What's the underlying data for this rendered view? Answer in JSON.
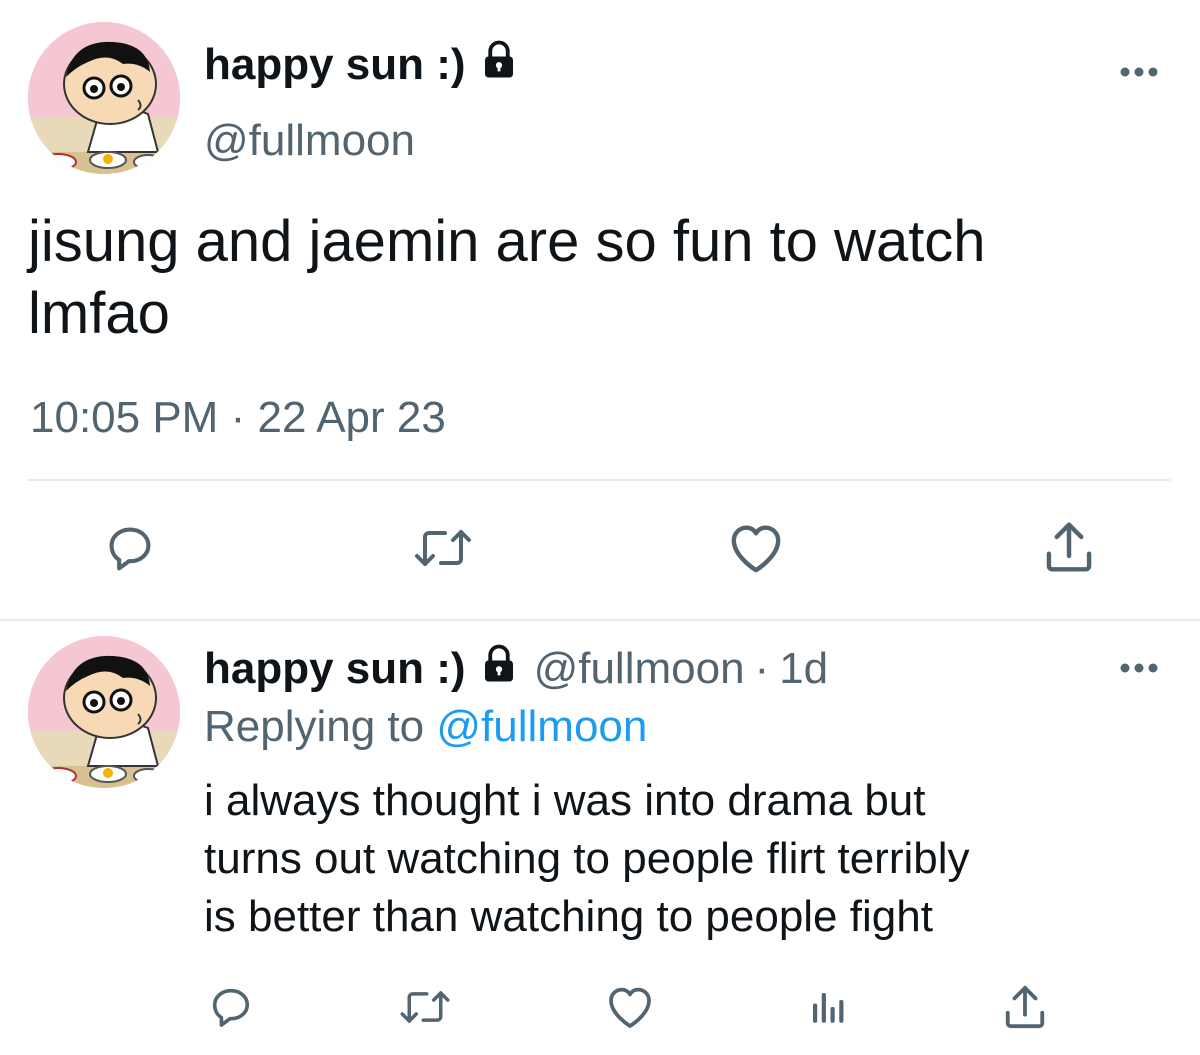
{
  "main_tweet": {
    "display_name": "happy sun :)",
    "handle": "@fullmoon",
    "text_line1": "jisung and jaemin are so fun to watch",
    "text_line2": "lmfao",
    "time": "10:05 PM",
    "separator": "·",
    "date": "22 Apr 23",
    "icons": [
      "lock-icon",
      "more-icon",
      "reply-icon",
      "retweet-icon",
      "like-icon",
      "share-icon"
    ]
  },
  "reply_tweet": {
    "display_name": "happy sun :)",
    "handle": "@fullmoon",
    "separator": "·",
    "age": "1d",
    "replying_prefix": "Replying to",
    "replying_handle": "@fullmoon",
    "text_line1": "i always thought i was into drama but",
    "text_line2": "turns out watching to people flirt terribly",
    "text_line3": "is better than watching to people fight",
    "icons": [
      "lock-icon",
      "more-icon",
      "reply-icon",
      "retweet-icon",
      "like-icon",
      "analytics-icon",
      "share-icon"
    ]
  },
  "colors": {
    "text": "#0f1419",
    "secondary": "#536471",
    "link": "#1d9bf0",
    "divider": "#e6e8ea"
  }
}
